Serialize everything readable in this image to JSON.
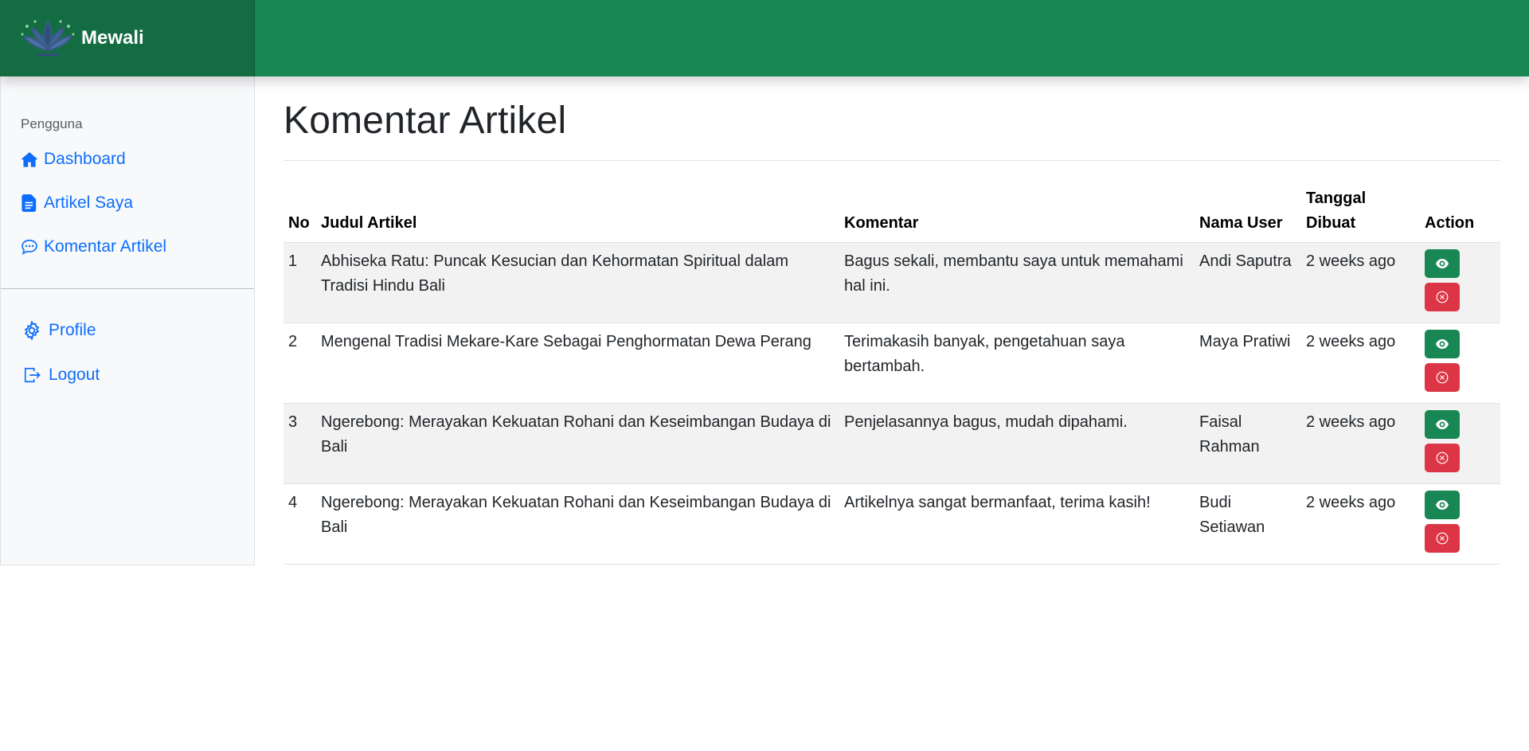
{
  "brand": {
    "name": "Mewali"
  },
  "sidebar": {
    "heading": "Pengguna",
    "items": [
      {
        "label": "Dashboard",
        "icon": "house-icon"
      },
      {
        "label": "Artikel Saya",
        "icon": "file-icon"
      },
      {
        "label": "Komentar Artikel",
        "icon": "chat-icon"
      }
    ],
    "bottom_items": [
      {
        "label": "Profile",
        "icon": "gear-icon"
      },
      {
        "label": "Logout",
        "icon": "logout-icon"
      }
    ]
  },
  "page": {
    "title": "Komentar Artikel"
  },
  "table": {
    "headers": {
      "no": "No",
      "title": "Judul Artikel",
      "comment": "Komentar",
      "user": "Nama User",
      "date": "Tanggal Dibuat",
      "action": "Action"
    },
    "rows": [
      {
        "no": "1",
        "title": "Abhiseka Ratu: Puncak Kesucian dan Kehormatan Spiritual dalam Tradisi Hindu Bali",
        "comment": "Bagus sekali, membantu saya untuk memahami hal ini.",
        "user": "Andi Saputra",
        "date": "2 weeks ago"
      },
      {
        "no": "2",
        "title": "Mengenal Tradisi Mekare-Kare Sebagai Penghormatan Dewa Perang",
        "comment": "Terimakasih banyak, pengetahuan saya bertambah.",
        "user": "Maya Pratiwi",
        "date": "2 weeks ago"
      },
      {
        "no": "3",
        "title": "Ngerebong: Merayakan Kekuatan Rohani dan Keseimbangan Budaya di Bali",
        "comment": "Penjelasannya bagus, mudah dipahami.",
        "user": "Faisal Rahman",
        "date": "2 weeks ago"
      },
      {
        "no": "4",
        "title": "Ngerebong: Merayakan Kekuatan Rohani dan Keseimbangan Budaya di Bali",
        "comment": "Artikelnya sangat bermanfaat, terima kasih!",
        "user": "Budi Setiawan",
        "date": "2 weeks ago"
      }
    ]
  },
  "colors": {
    "primary_green": "#198754",
    "dark_green": "#146c43",
    "link_blue": "#0d6efd",
    "danger_red": "#dc3545"
  }
}
